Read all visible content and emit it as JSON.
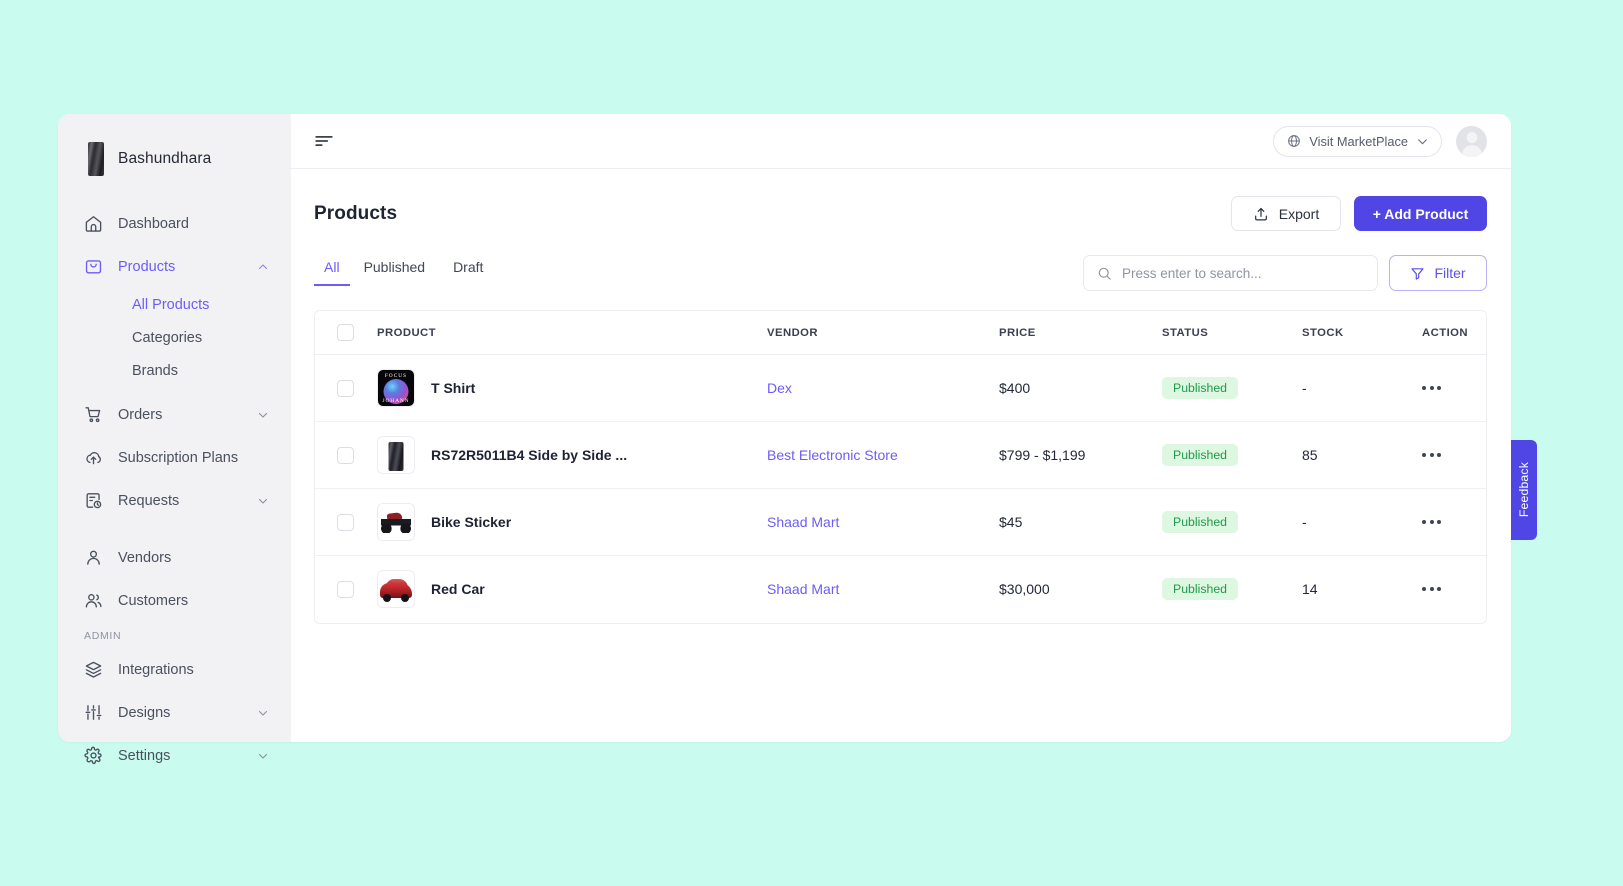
{
  "brand": {
    "name": "Bashundhara",
    "logo_icon": "building-logo"
  },
  "sidebar": {
    "items": [
      {
        "label": "Dashboard",
        "icon": "home-icon",
        "expandable": false,
        "active": false
      },
      {
        "label": "Products",
        "icon": "bag-icon",
        "expandable": true,
        "expanded": true,
        "active": true
      },
      {
        "label": "Orders",
        "icon": "cart-icon",
        "expandable": true,
        "active": false
      },
      {
        "label": "Subscription Plans",
        "icon": "cloud-upload-icon",
        "expandable": false,
        "active": false
      },
      {
        "label": "Requests",
        "icon": "file-clock-icon",
        "expandable": true,
        "active": false
      },
      {
        "label": "Vendors",
        "icon": "user-icon",
        "expandable": false,
        "active": false
      },
      {
        "label": "Customers",
        "icon": "users-icon",
        "expandable": false,
        "active": false
      }
    ],
    "sub_items": [
      {
        "label": "All Products",
        "active": true
      },
      {
        "label": "Categories",
        "active": false
      },
      {
        "label": "Brands",
        "active": false
      }
    ],
    "admin_section_label": "ADMIN",
    "admin_items": [
      {
        "label": "Integrations",
        "icon": "layers-icon",
        "expandable": false
      },
      {
        "label": "Designs",
        "icon": "sliders-icon",
        "expandable": true
      },
      {
        "label": "Settings",
        "icon": "gear-icon",
        "expandable": true
      }
    ]
  },
  "topbar": {
    "menu_icon": "hamburger-icon",
    "marketplace_label": "Visit MarketPlace",
    "marketplace_icon": "globe-icon",
    "marketplace_chevron": "chevron-down-icon",
    "avatar_icon": "user-avatar"
  },
  "page": {
    "title": "Products",
    "export_label": "Export",
    "export_icon": "upload-icon",
    "add_product_label": "+ Add Product"
  },
  "tabs": [
    {
      "label": "All",
      "active": true
    },
    {
      "label": "Published",
      "active": false
    },
    {
      "label": "Draft",
      "active": false
    }
  ],
  "search": {
    "placeholder": "Press enter to search...",
    "value": "",
    "icon": "search-icon"
  },
  "filter": {
    "label": "Filter",
    "icon": "funnel-icon"
  },
  "table": {
    "columns": [
      "PRODUCT",
      "VENDOR",
      "PRICE",
      "STATUS",
      "STOCK",
      "ACTION"
    ],
    "rows": [
      {
        "product": "T Shirt",
        "thumb": "tshirt-focus-johann",
        "vendor": "Dex",
        "price": "$400",
        "status": "Published",
        "stock": "-",
        "action_icon": "more-dots-icon"
      },
      {
        "product": "RS72R5011B4 Side by Side ...",
        "thumb": "refrigerator",
        "vendor": "Best Electronic Store",
        "price": "$799 - $1,199",
        "status": "Published",
        "stock": "85",
        "action_icon": "more-dots-icon"
      },
      {
        "product": "Bike Sticker",
        "thumb": "motorcycle",
        "vendor": "Shaad Mart",
        "price": "$45",
        "status": "Published",
        "stock": "-",
        "action_icon": "more-dots-icon"
      },
      {
        "product": "Red Car",
        "thumb": "red-car",
        "vendor": "Shaad Mart",
        "price": "$30,000",
        "status": "Published",
        "stock": "14",
        "action_icon": "more-dots-icon"
      }
    ]
  },
  "feedback": {
    "label": "Feedback"
  },
  "colors": {
    "accent": "#4f46e5",
    "accent_light": "#6d5cf7",
    "page_background": "#c9fbee",
    "sidebar_background": "#f2f2f5",
    "status_badge_bg": "#ddf7e0",
    "status_badge_text": "#1f9a4d"
  }
}
